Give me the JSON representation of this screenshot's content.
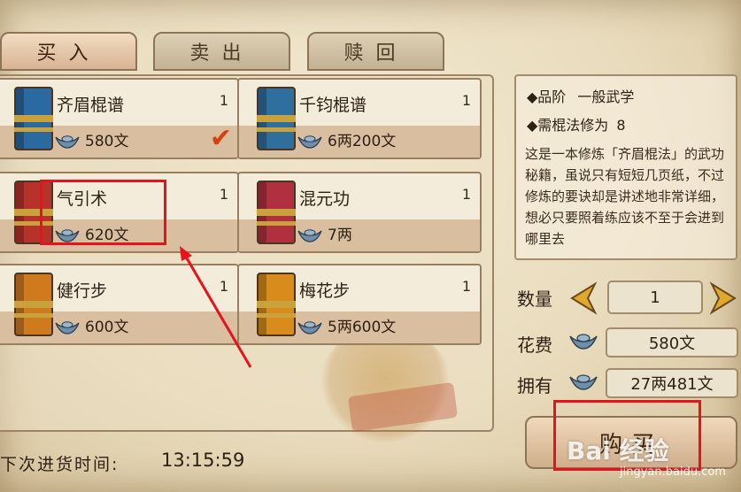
{
  "colors": {
    "accent_red": "#e8121c",
    "check": "#d8400c",
    "parchment": "#efe3c8"
  },
  "tabs": [
    {
      "label": "买入",
      "active": true
    },
    {
      "label": "卖出",
      "active": false
    },
    {
      "label": "赎回",
      "active": false
    }
  ],
  "items": [
    {
      "name": "齐眉棍谱",
      "count": "1",
      "price": "580文",
      "book_color": "#2a6aa0",
      "selected": true
    },
    {
      "name": "千钧棍谱",
      "count": "1",
      "price": "6两200文",
      "book_color": "#2f6f9e",
      "selected": false
    },
    {
      "name": "气引术",
      "count": "1",
      "price": "620文",
      "book_color": "#b8322b",
      "selected": false
    },
    {
      "name": "混元功",
      "count": "1",
      "price": "7两",
      "book_color": "#b03040",
      "selected": false
    },
    {
      "name": "健行步",
      "count": "1",
      "price": "600文",
      "book_color": "#d07a1e",
      "selected": false
    },
    {
      "name": "梅花步",
      "count": "1",
      "price": "5两600文",
      "book_color": "#d98c1c",
      "selected": false
    }
  ],
  "detail": {
    "grade_label": "◆品阶",
    "grade_value": "一般武学",
    "req_label": "◆需棍法修为",
    "req_value": "8",
    "description": "这是一本修炼「齐眉棍法」的武功秘籍，虽说只有短短几页纸，不过修炼的要诀却是讲述地非常详细，想必只要照着练应该不至于会进到哪里去"
  },
  "quantity": {
    "label": "数量",
    "value": "1"
  },
  "cost": {
    "label": "花费",
    "value": "580文"
  },
  "owned": {
    "label": "拥有",
    "value": "27两481文"
  },
  "buy_button": {
    "label": "购买"
  },
  "restock": {
    "label": "下次进货时间:",
    "time": "13:15:59"
  },
  "watermark": {
    "brand": "Bai 经验",
    "url": "jingyan.baidu.com"
  }
}
